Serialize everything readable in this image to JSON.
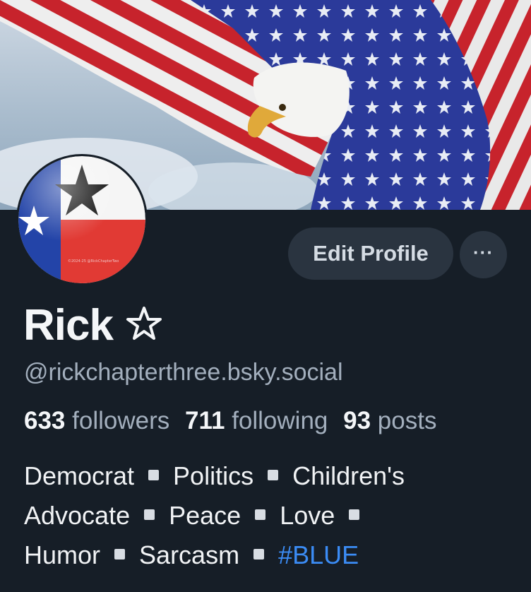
{
  "profile": {
    "display_name": "Rick",
    "name_badge": "☆",
    "handle": "@rickchapterthree.bsky.social",
    "avatar_caption": "©2024-25 @RickChapterTwo"
  },
  "actions": {
    "edit_profile_label": "Edit Profile",
    "more_label": "···"
  },
  "stats": [
    {
      "value": "633",
      "label": "followers"
    },
    {
      "value": "711",
      "label": "following"
    },
    {
      "value": "93",
      "label": "posts"
    }
  ],
  "bio": {
    "lines": [
      [
        "Democrat",
        "Politics",
        "Children's"
      ],
      [
        "Advocate",
        "Peace",
        "Love"
      ],
      [
        "Humor",
        "Sarcasm"
      ]
    ],
    "trailing_separators": [
      false,
      true,
      true
    ],
    "hashtag": "#BLUE"
  },
  "colors": {
    "background": "#161e27",
    "button_bg": "#2a3440",
    "muted_text": "#a3afbd",
    "link": "#3b8cf5"
  },
  "icons": {
    "banner": "flag-eagle-banner",
    "avatar": "texas-flag-avatar",
    "badge": "star-outline-icon",
    "separator": "square-bullet-icon"
  }
}
